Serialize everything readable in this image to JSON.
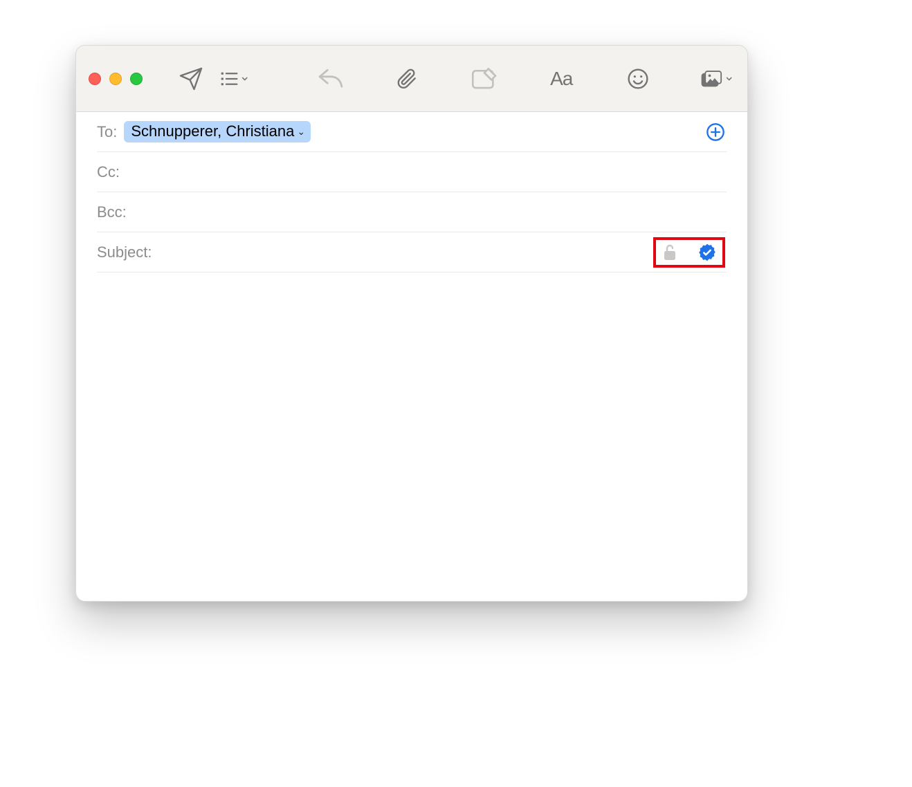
{
  "toolbar": {
    "icons": {
      "send": "send-icon",
      "list": "list-icon",
      "reply": "reply-icon",
      "attach": "attachment-icon",
      "markup": "markup-attachment-icon",
      "format": "text-format-icon",
      "emoji": "emoji-icon",
      "media": "photo-browser-icon"
    },
    "format_label": "Aa"
  },
  "fields": {
    "to": {
      "label": "To:",
      "recipients": [
        {
          "name": "Schnupperer, Christiana"
        }
      ]
    },
    "cc": {
      "label": "Cc:",
      "value": ""
    },
    "bcc": {
      "label": "Bcc:",
      "value": ""
    },
    "subject": {
      "label": "Subject:",
      "value": "",
      "security": {
        "encryption": "unlocked",
        "signed": true
      }
    }
  },
  "body": {
    "text": ""
  },
  "colors": {
    "accent_blue": "#1f72e8",
    "chip_bg": "#b7d6fc",
    "highlight_red": "#e30613"
  }
}
